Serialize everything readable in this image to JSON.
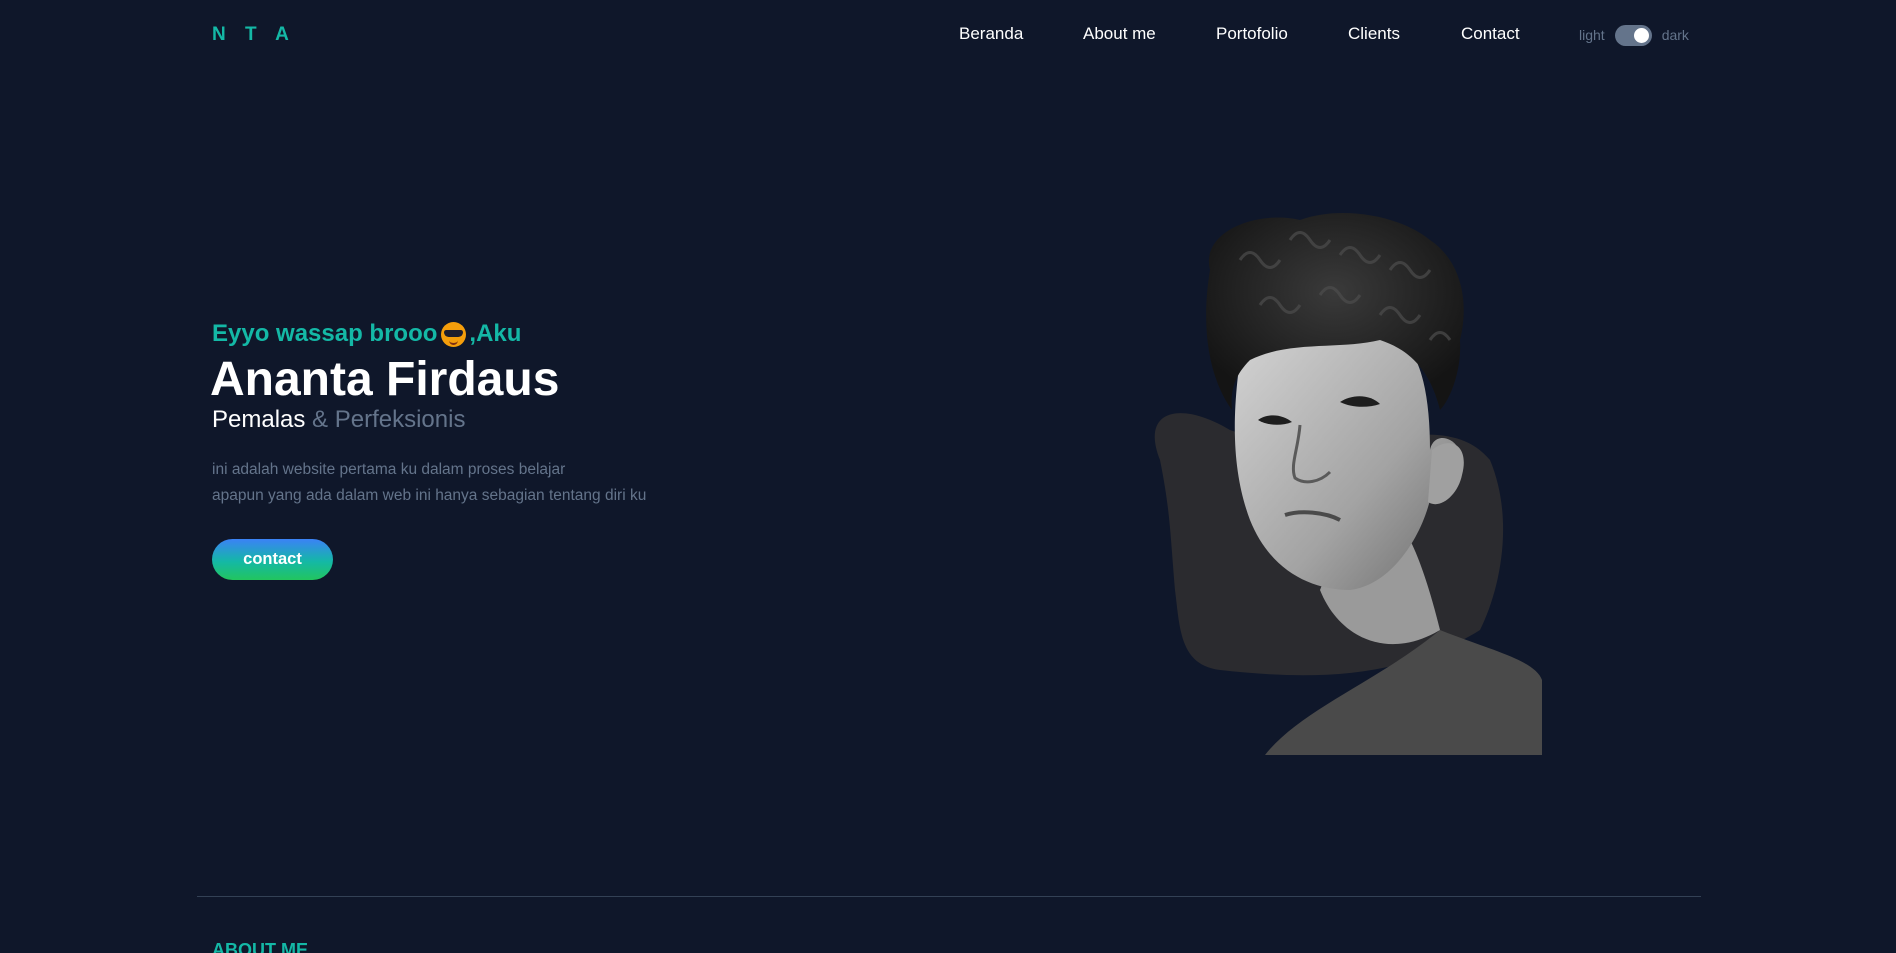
{
  "navbar": {
    "logo": "N T A",
    "links": [
      "Beranda",
      "About me",
      "Portofolio",
      "Clients",
      "Contact"
    ],
    "theme_toggle": {
      "light_label": "light",
      "dark_label": "dark",
      "state": "dark"
    }
  },
  "hero": {
    "greeting_prefix": "Eyyo wassap brooo",
    "greeting_emoji": "sunglasses-emoji",
    "greeting_suffix": ",Aku",
    "name": "Ananta Firdaus",
    "role_primary": "Pemalas",
    "role_secondary": " & Perfeksionis",
    "description_line1": "ini adalah website pertama ku dalam proses belajar",
    "description_line2": "apapun yang ada dalam web ini hanya sebagian tentang diri ku",
    "button_label": "contact",
    "portrait": "grayscale-portrait-photo"
  },
  "about": {
    "title": "ABOUT ME"
  },
  "colors": {
    "background": "#0f172a",
    "accent": "#14b8a6",
    "muted": "#64748b",
    "text": "#ffffff"
  }
}
